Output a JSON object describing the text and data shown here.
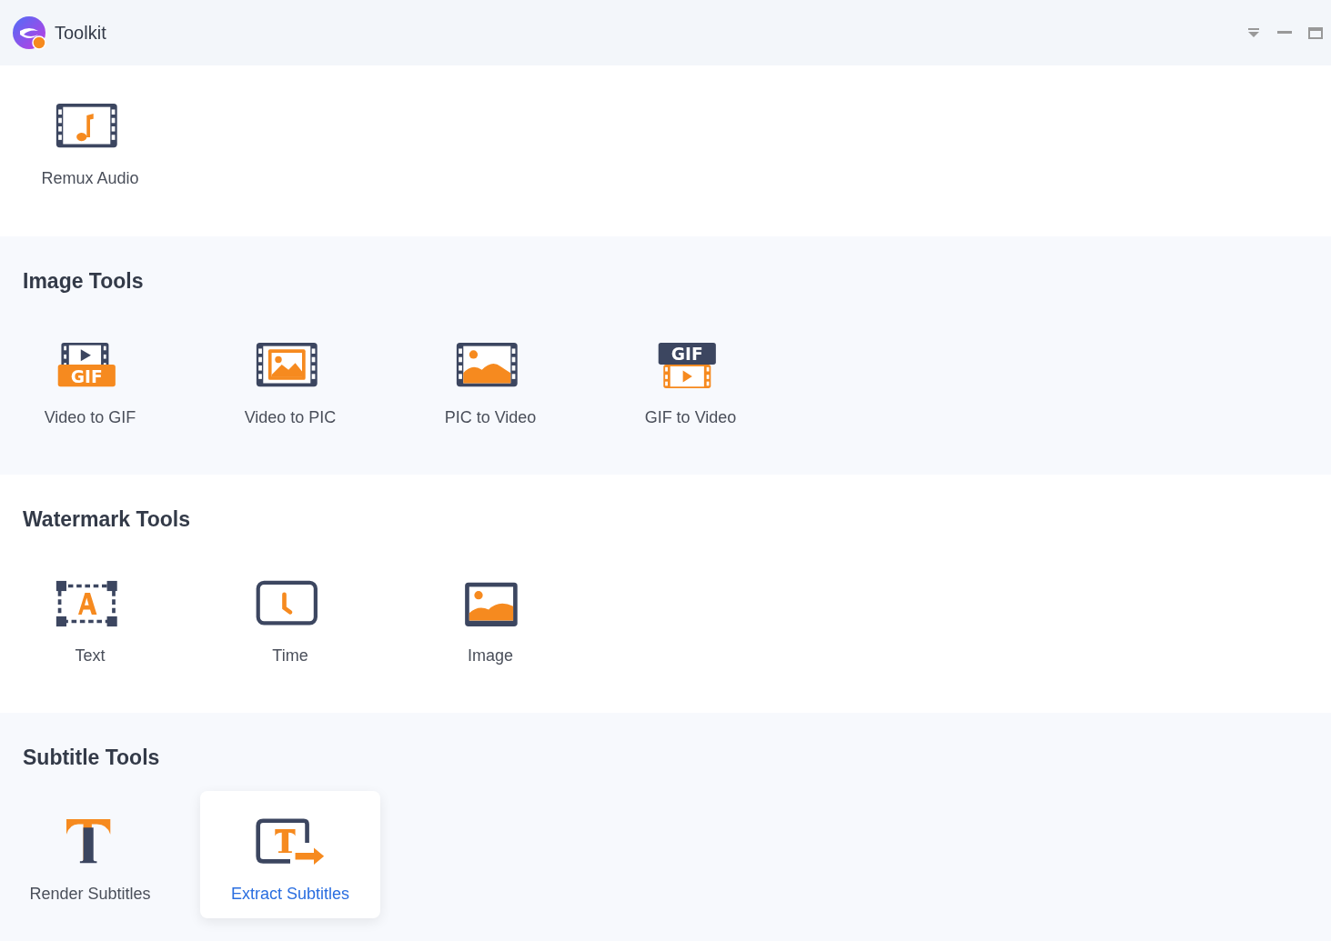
{
  "window": {
    "title": "Toolkit"
  },
  "sections": [
    {
      "tools": [
        {
          "label": "Remux Audio",
          "kind": "remux-audio",
          "selected": false
        }
      ]
    },
    {
      "title": "Image Tools",
      "tools": [
        {
          "label": "Video to GIF",
          "kind": "video-to-gif",
          "icon_text": "GIF",
          "selected": false
        },
        {
          "label": "Video to PIC",
          "kind": "video-to-pic",
          "selected": false
        },
        {
          "label": "PIC to Video",
          "kind": "pic-to-video",
          "selected": false
        },
        {
          "label": "GIF to Video",
          "kind": "gif-to-video",
          "icon_text": "GIF",
          "selected": false
        }
      ]
    },
    {
      "title": "Watermark Tools",
      "tools": [
        {
          "label": "Text",
          "kind": "text-watermark",
          "selected": false
        },
        {
          "label": "Time",
          "kind": "time-watermark",
          "selected": false
        },
        {
          "label": "Image",
          "kind": "image-watermark",
          "selected": false
        }
      ]
    },
    {
      "title": "Subtitle Tools",
      "tools": [
        {
          "label": "Render Subtitles",
          "kind": "render-subtitles",
          "selected": false
        },
        {
          "label": "Extract Subtitles",
          "kind": "extract-subtitles",
          "selected": true
        }
      ]
    }
  ]
}
